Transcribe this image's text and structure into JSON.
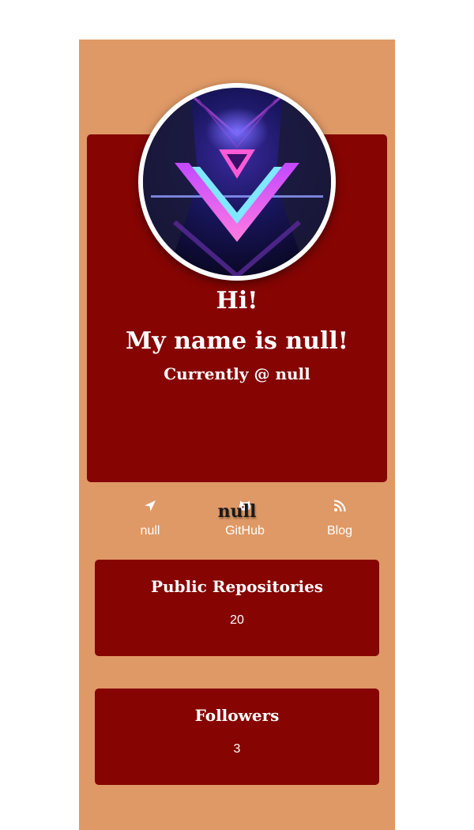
{
  "profile": {
    "greeting": "Hi!",
    "name_line": "My name is null!",
    "company_line": "Currently @ null",
    "bio": "null",
    "avatar": "avatar-image"
  },
  "links": [
    {
      "label": "null",
      "icon": "location-arrow-icon"
    },
    {
      "label": "GitHub",
      "icon": "github-icon"
    },
    {
      "label": "Blog",
      "icon": "rss-icon"
    }
  ],
  "stats": [
    {
      "title": "Public Repositories",
      "value": "20"
    },
    {
      "title": "Followers",
      "value": "3"
    }
  ],
  "colors": {
    "page_background": "#ffffff",
    "panel_background": "#df9966",
    "card_background": "#860503",
    "text_on_card": "#ffffff"
  }
}
